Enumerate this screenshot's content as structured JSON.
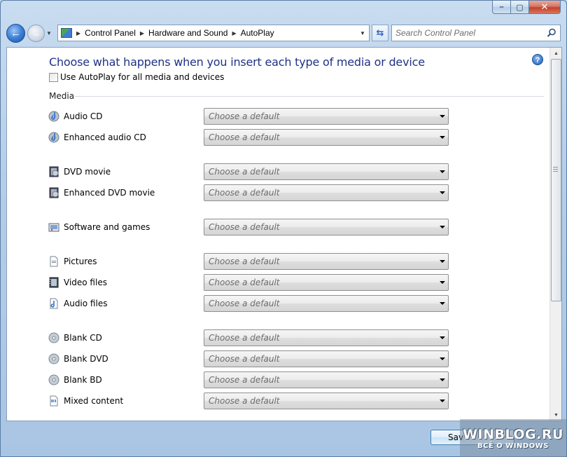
{
  "window": {
    "controls": {
      "minimize": "–",
      "maximize": "▢",
      "close": "✕"
    }
  },
  "nav": {
    "back_icon": "back-arrow-icon",
    "forward_icon": "forward-arrow-icon",
    "breadcrumbs": [
      "Control Panel",
      "Hardware and Sound",
      "AutoPlay"
    ],
    "search_placeholder": "Search Control Panel"
  },
  "page": {
    "heading": "Choose what happens when you insert each type of media or device",
    "autoplay_checkbox_label": "Use AutoPlay for all media and devices",
    "autoplay_checked": false,
    "section_label": "Media",
    "help_icon": "?"
  },
  "media": [
    {
      "label": "Audio CD",
      "icon": "audio-cd-icon",
      "value": "Choose a default"
    },
    {
      "label": "Enhanced audio CD",
      "icon": "enhanced-audio-cd-icon",
      "value": "Choose a default"
    },
    {
      "label": "DVD movie",
      "icon": "dvd-movie-icon",
      "value": "Choose a default"
    },
    {
      "label": "Enhanced DVD movie",
      "icon": "enhanced-dvd-movie-icon",
      "value": "Choose a default"
    },
    {
      "label": "Software and games",
      "icon": "software-games-icon",
      "value": "Choose a default"
    },
    {
      "label": "Pictures",
      "icon": "pictures-icon",
      "value": "Choose a default"
    },
    {
      "label": "Video files",
      "icon": "video-files-icon",
      "value": "Choose a default"
    },
    {
      "label": "Audio files",
      "icon": "audio-files-icon",
      "value": "Choose a default"
    },
    {
      "label": "Blank CD",
      "icon": "blank-cd-icon",
      "value": "Choose a default"
    },
    {
      "label": "Blank DVD",
      "icon": "blank-dvd-icon",
      "value": "Choose a default"
    },
    {
      "label": "Blank BD",
      "icon": "blank-bd-icon",
      "value": "Choose a default"
    },
    {
      "label": "Mixed content",
      "icon": "mixed-content-icon",
      "value": "Choose a default"
    }
  ],
  "footer": {
    "save_label": "Sav"
  },
  "watermark": {
    "title": "WINBLOG.RU",
    "subtitle": "ВСЁ О WINDOWS"
  },
  "colors": {
    "heading": "#1e3287",
    "frame": "#b9d1ea",
    "close_button": "#c2432c"
  }
}
